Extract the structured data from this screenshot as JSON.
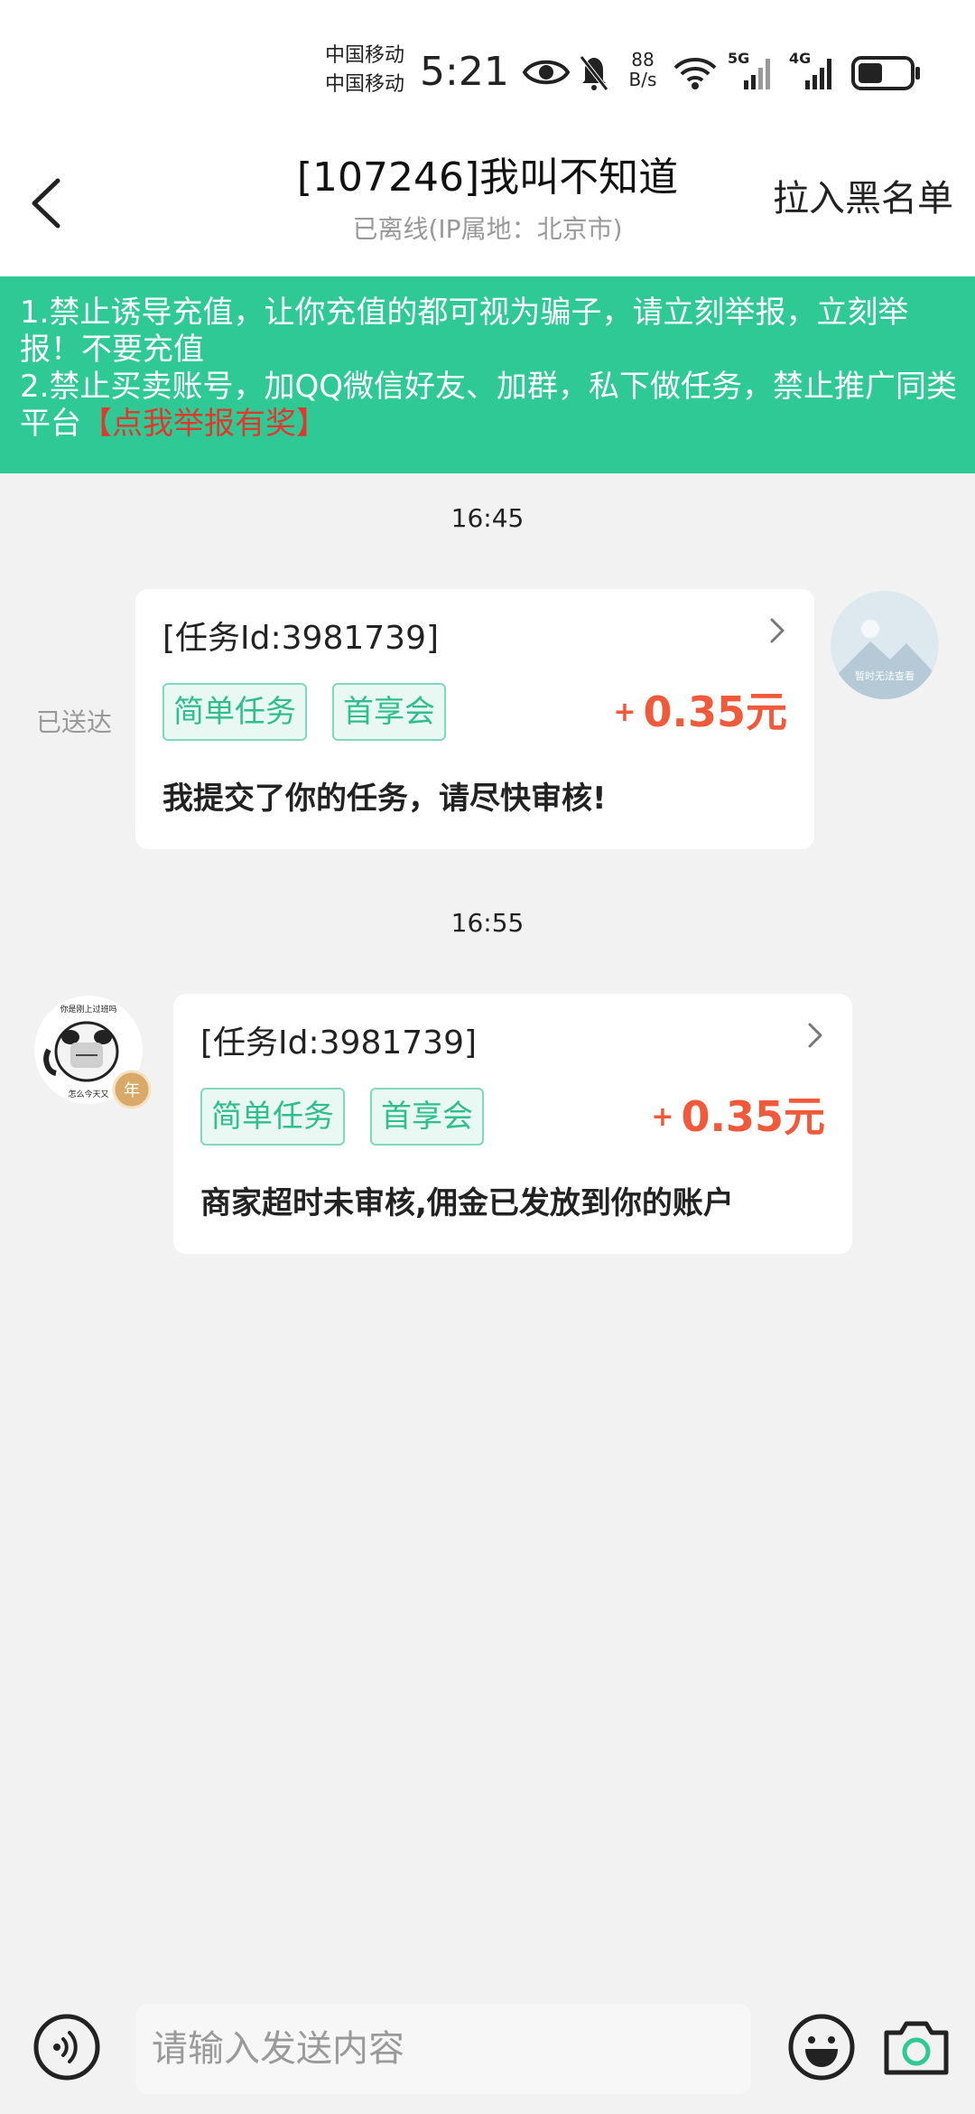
{
  "status_bar": {
    "carrier_1": "中国移动",
    "carrier_2": "中国移动",
    "time": "5:21",
    "net_speed_value": "88",
    "net_speed_unit": "B/s",
    "signal_1_label": "5G",
    "signal_2_label": "4G",
    "icons": [
      "eye-icon",
      "bell-off-icon",
      "wifi-icon",
      "signal-5g-icon",
      "signal-4g-icon",
      "battery-icon"
    ]
  },
  "header": {
    "title": "[107246]我叫不知道",
    "subtitle": "已离线(IP属地：北京市)",
    "blacklist_label": "拉入黑名单"
  },
  "notice": {
    "line1": "1.禁止诱导充值，让你充值的都可视为骗子，请立刻举报，立刻举报！不要充值",
    "line2": "2.禁止买卖账号，加QQ微信好友、加群，私下做任务，禁止推广同类平台",
    "report_link": "【点我举报有奖】"
  },
  "messages": [
    {
      "time": "16:45",
      "side": "right",
      "status": "已送达",
      "avatar_caption": "暂时无法查看",
      "task_id": "[任务Id:3981739]",
      "tags": [
        "简单任务",
        "首享会"
      ],
      "reward_sign": "+",
      "reward": "0.35元",
      "text": "我提交了你的任务，请尽快审核!"
    },
    {
      "time": "16:55",
      "side": "left",
      "avatar_caption_top": "你是刚上过班吗",
      "avatar_caption_bottom": "怎么今天又",
      "avatar_badge": "年",
      "task_id": "[任务Id:3981739]",
      "tags": [
        "简单任务",
        "首享会"
      ],
      "reward_sign": "+",
      "reward": "0.35元",
      "text": "商家超时未审核,佣金已发放到你的账户"
    }
  ],
  "input_bar": {
    "placeholder": "请输入发送内容"
  },
  "colors": {
    "accent_green": "#2ec995",
    "reward_red": "#f05a3a",
    "link_red": "#e8352c",
    "tag_text": "#2fbf8f"
  }
}
